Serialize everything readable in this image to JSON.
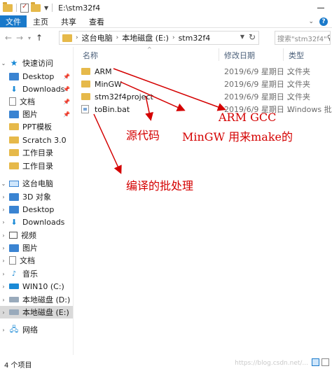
{
  "window": {
    "title": "E:\\stm32f4"
  },
  "ribbon": {
    "tabs": [
      "文件",
      "主页",
      "共享",
      "查看"
    ]
  },
  "address": {
    "crumbs": [
      "这台电脑",
      "本地磁盘 (E:)",
      "stm32f4"
    ],
    "search_placeholder": "搜索\"stm32f4\""
  },
  "sidebar": {
    "quick_access": "快速访问",
    "items": [
      "Desktop",
      "Downloads",
      "文档",
      "图片",
      "PPT模板",
      "Scratch 3.0",
      "工作目录",
      "工作目录"
    ],
    "this_pc": "这台电脑",
    "pc_items": [
      "3D 对象",
      "Desktop",
      "Downloads",
      "视频",
      "图片",
      "文档",
      "音乐",
      "WIN10 (C:)",
      "本地磁盘 (D:)",
      "本地磁盘 (E:)"
    ],
    "network": "网络"
  },
  "columns": {
    "name": "名称",
    "date": "修改日期",
    "type": "类型"
  },
  "files": [
    {
      "name": "ARM",
      "date": "2019/6/9 星期日 ...",
      "type": "文件夹",
      "kind": "folder"
    },
    {
      "name": "MinGW",
      "date": "2019/6/9 星期日 ...",
      "type": "文件夹",
      "kind": "folder"
    },
    {
      "name": "stm32f4project",
      "date": "2019/6/9 星期日 ...",
      "type": "文件夹",
      "kind": "folder"
    },
    {
      "name": "toBin.bat",
      "date": "2019/6/9 星期日 ...",
      "type": "Windows 批处",
      "kind": "file"
    }
  ],
  "annotations": {
    "arm_gcc": "ARM GCC",
    "source": "源代码",
    "mingw": "MinGW 用来make的",
    "batch": "编译的批处理"
  },
  "status": {
    "count": "4 个项目"
  },
  "watermark": "https://blog.csdn.net/..."
}
